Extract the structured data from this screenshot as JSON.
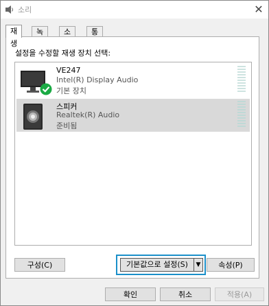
{
  "window": {
    "title": "소리",
    "close_glyph": "✕"
  },
  "tabs": [
    {
      "label": "재생",
      "active": true
    },
    {
      "label": "녹음",
      "active": false
    },
    {
      "label": "소리",
      "active": false
    },
    {
      "label": "통신",
      "active": false
    }
  ],
  "panel": {
    "instruction": "설정을 수정할 재생 장치 선택:"
  },
  "devices": [
    {
      "name": "VE247",
      "driver": "Intel(R) Display Audio",
      "status": "기본 장치",
      "icon": "monitor-icon",
      "badge": "default-check-icon",
      "selected": false
    },
    {
      "name": "스피커",
      "driver": "Realtek(R) Audio",
      "status": "준비됨",
      "icon": "speaker-icon",
      "selected": true
    }
  ],
  "buttons": {
    "configure": "구성(C)",
    "set_default": "기본값으로 설정(S)",
    "properties": "속성(P)",
    "ok": "확인",
    "cancel": "취소",
    "apply": "적용(A)"
  },
  "colors": {
    "highlight": "#1a8fc9",
    "check": "#1aaa44",
    "selection": "#d9d9d9"
  }
}
